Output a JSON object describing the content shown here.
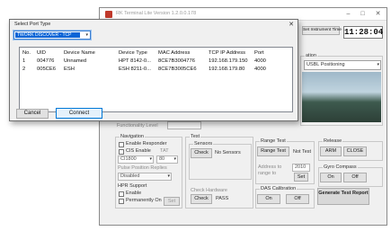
{
  "app": {
    "title": "RK Terminal Lite Version 1.2.0.0.178",
    "instrument_time_label": "Set Instrument Time",
    "clock": "11:28:04",
    "positioning": {
      "title": "ation",
      "mode": "USBL Positioning"
    },
    "functionality_label": "Functionality Level",
    "navigation": {
      "title": "Navigation",
      "enable_responder": "Enable Responder",
      "cis_enable": "CIS Enable",
      "tat_label": "TAT",
      "channel_value": "CI1800",
      "tat_value": "80",
      "pulse_title": "Pulse Position Replies",
      "pulse_value": "Disabled"
    },
    "hpr": {
      "title": "HPR Support",
      "enable": "Enable",
      "permanently_on": "Permanently On",
      "set": "Set"
    },
    "test": {
      "title": "Test",
      "sensors_title": "Sensors",
      "check": "Check",
      "no_sensors": "No Sensors"
    },
    "hardware": {
      "title": "Check Hardware",
      "check": "Check",
      "status": "PASS"
    },
    "range_test": {
      "title": "Range Test",
      "button": "Range Test",
      "status": "Not Test",
      "address_label": "Address to range to",
      "address_value": "2010",
      "set": "Set"
    },
    "release": {
      "title": "Release",
      "arm": "ARM",
      "close": "CLOSE"
    },
    "gyro": {
      "title": "Gyro Compass",
      "on": "On",
      "off": "Off"
    },
    "das": {
      "title": "DAS Calibration",
      "on": "On",
      "off": "Off"
    },
    "generate": "Generate Test Report"
  },
  "dialog": {
    "title": "Select Port Type",
    "close_glyph": "✕",
    "scan_option": "TWORK DISCOVER - TCP",
    "columns": [
      "No.",
      "UID",
      "Device Name",
      "Device Type",
      "MAC Address",
      "TCP IP Address",
      "Port"
    ],
    "rows": [
      [
        "1",
        "004776",
        "Unnamed",
        "HPT 8142-0...",
        "8CE7B3004776",
        "192.168.179.150",
        "4000"
      ],
      [
        "2",
        "005CE6",
        "ESH",
        "ESH 8211-0...",
        "8CE7B3005CE6",
        "192.168.179.80",
        "4000"
      ]
    ],
    "cancel": "Cancel",
    "connect": "Connect"
  }
}
